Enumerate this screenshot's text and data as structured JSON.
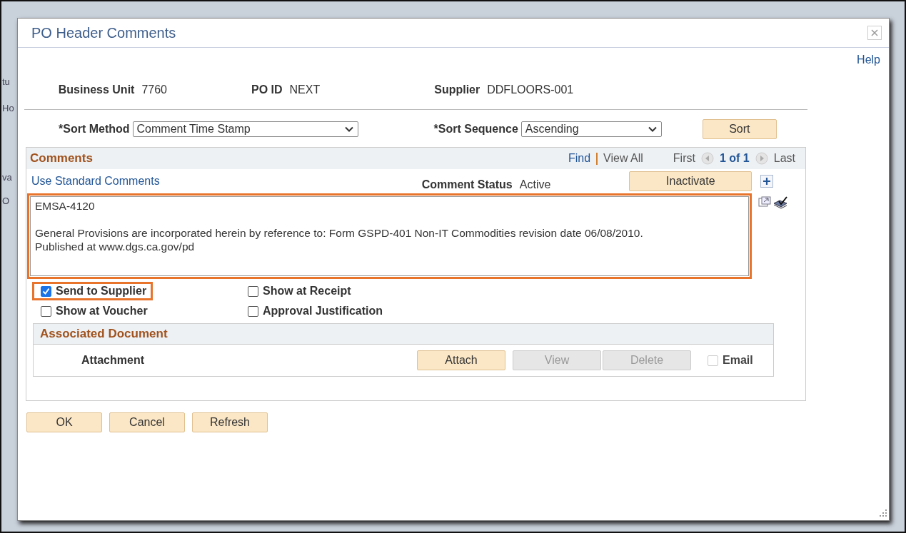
{
  "background_fragments": [
    "tu",
    "Ho",
    "va",
    "O"
  ],
  "dialog": {
    "title": "PO Header Comments",
    "help_link": "Help",
    "header_fields": [
      {
        "label": "Business Unit",
        "value": "7760"
      },
      {
        "label": "PO ID",
        "value": "NEXT"
      },
      {
        "label": "Supplier",
        "value": "DDFLOORS-001"
      }
    ],
    "sort": {
      "method": {
        "label": "*Sort Method",
        "value": "Comment Time Stamp"
      },
      "sequence": {
        "label": "*Sort Sequence",
        "value": "Ascending"
      },
      "button": "Sort"
    },
    "comments": {
      "title": "Comments",
      "find": "Find",
      "view_all": "View All",
      "first": "First",
      "page": "1 of 1",
      "last": "Last",
      "standard_link": "Use Standard Comments",
      "status_label": "Comment Status",
      "status_value": "Active",
      "inactivate_button": "Inactivate",
      "text": {
        "value": "EMSA-4120\n\nGeneral Provisions are incorporated herein by reference to: Form GSPD-401 Non-IT Commodities revision date 06/08/2010.\nPublished at www.dgs.ca.gov/pd",
        "highlighted": true
      },
      "options": [
        {
          "label": "Send to Supplier",
          "checked": true,
          "highlighted": true
        },
        {
          "label": "Show at Receipt",
          "checked": false,
          "highlighted": false
        },
        {
          "label": "Show at Voucher",
          "checked": false,
          "highlighted": false
        },
        {
          "label": "Approval Justification",
          "checked": false,
          "highlighted": false
        }
      ],
      "associated": {
        "title": "Associated Document",
        "attachment_label": "Attachment",
        "buttons": [
          {
            "label": "Attach",
            "disabled": false
          },
          {
            "label": "View",
            "disabled": true
          },
          {
            "label": "Delete",
            "disabled": true
          }
        ],
        "email": {
          "label": "Email",
          "checked": false,
          "disabled": true
        }
      }
    },
    "buttons": [
      "OK",
      "Cancel",
      "Refresh"
    ]
  }
}
